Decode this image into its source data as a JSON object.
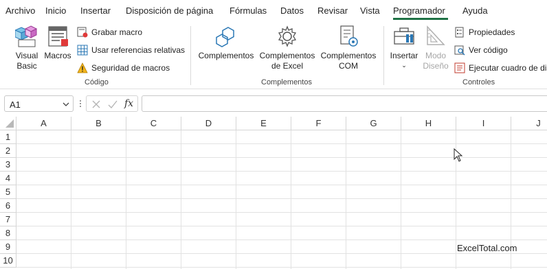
{
  "menu": {
    "items": [
      "Archivo",
      "Inicio",
      "Insertar",
      "Disposición de página",
      "Fórmulas",
      "Datos",
      "Revisar",
      "Vista",
      "Programador",
      "Ayuda"
    ],
    "active": "Programador"
  },
  "ribbon": {
    "codigo": {
      "label": "Código",
      "visual_basic": [
        "Visual",
        "Basic"
      ],
      "macros": "Macros",
      "grabar_macro": "Grabar macro",
      "referencias_relativas": "Usar referencias relativas",
      "seguridad_macros": "Seguridad de macros"
    },
    "complementos": {
      "label": "Complementos",
      "complementos": "Complementos",
      "complementos_excel": [
        "Complementos",
        "de Excel"
      ],
      "complementos_com": [
        "Complementos",
        "COM"
      ]
    },
    "controles": {
      "label": "Controles",
      "insertar": "Insertar",
      "modo_diseno": [
        "Modo",
        "Diseño"
      ],
      "propiedades": "Propiedades",
      "ver_codigo": "Ver código",
      "ejecutar_cuadro": "Ejecutar cuadro de diá"
    }
  },
  "formula_bar": {
    "name_box": "A1",
    "fx": "fx",
    "value": ""
  },
  "grid": {
    "columns": [
      "A",
      "B",
      "C",
      "D",
      "E",
      "F",
      "G",
      "H",
      "I",
      "J"
    ],
    "rows": [
      "1",
      "2",
      "3",
      "4",
      "5",
      "6",
      "7",
      "8",
      "9",
      "10"
    ]
  },
  "watermark": "ExcelTotal.com",
  "colors": {
    "accent": "#1e7145",
    "gridline": "#e2e2e2",
    "header_border": "#d5d5d5"
  }
}
